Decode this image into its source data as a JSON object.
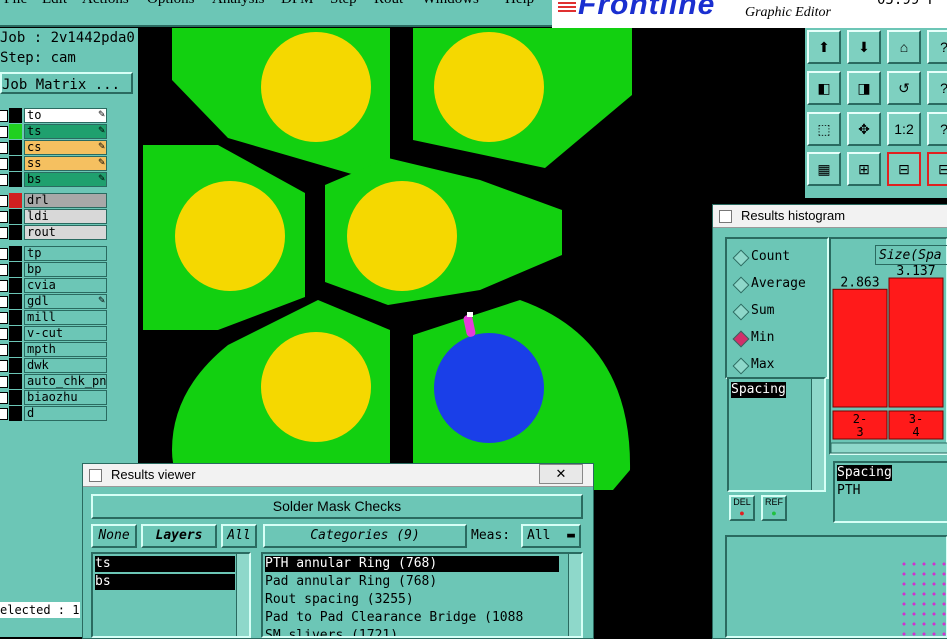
{
  "menu": {
    "items": [
      "File",
      "Edit",
      "Actions",
      "Options",
      "Analysis",
      "DFM",
      "Step",
      "Rout",
      "Windows",
      "Help"
    ]
  },
  "logo": {
    "brand": "Frontline",
    "subtitle": "Graphic Editor",
    "version": "05.99 F"
  },
  "job": {
    "name_line": "Job : 2v1442pda0",
    "step_line": "Step: cam",
    "matrix_label": "Job Matrix ..."
  },
  "layers": [
    {
      "name": "to",
      "color": "#ffffff",
      "editable": true
    },
    {
      "name": "ts",
      "color": "#1fa06e",
      "editable": true
    },
    {
      "name": "cs",
      "color": "#f5c060",
      "editable": true
    },
    {
      "name": "ss",
      "color": "#f5c060",
      "editable": true
    },
    {
      "name": "bs",
      "color": "#1fa06e",
      "editable": true
    },
    {
      "name": "drl",
      "color": "#a8a8a8",
      "editable": false
    },
    {
      "name": "ldi",
      "color": "#d8d8d8",
      "editable": false
    },
    {
      "name": "rout",
      "color": "#d8d8d8",
      "editable": false
    },
    {
      "name": "tp",
      "color": "#6cc6b6",
      "editable": false
    },
    {
      "name": "bp",
      "color": "#6cc6b6",
      "editable": false
    },
    {
      "name": "cvia",
      "color": "#6cc6b6",
      "editable": false
    },
    {
      "name": "gdl",
      "color": "#6cc6b6",
      "editable": true
    },
    {
      "name": "mill",
      "color": "#6cc6b6",
      "editable": false
    },
    {
      "name": "v-cut",
      "color": "#6cc6b6",
      "editable": false
    },
    {
      "name": "mpth",
      "color": "#6cc6b6",
      "editable": false
    },
    {
      "name": "dwk",
      "color": "#6cc6b6",
      "editable": false
    },
    {
      "name": "auto_chk_pn",
      "color": "#6cc6b6",
      "editable": false
    },
    {
      "name": "biaozhu",
      "color": "#6cc6b6",
      "editable": false
    },
    {
      "name": "d",
      "color": "#6cc6b6",
      "editable": false
    }
  ],
  "status": {
    "selected": "elected : 1"
  },
  "histogram": {
    "window_title": "Results histogram",
    "modes": [
      {
        "label": "Count",
        "selected": false
      },
      {
        "label": "Average",
        "selected": false
      },
      {
        "label": "Sum",
        "selected": false
      },
      {
        "label": "Min",
        "selected": true
      },
      {
        "label": "Max",
        "selected": false
      }
    ],
    "size_label": "Size(Spa",
    "list_items": [
      "Spacing"
    ],
    "del_label": "DEL",
    "ref_label": "REF",
    "lower_items": [
      "Spacing",
      "PTH"
    ]
  },
  "chart_data": {
    "type": "bar",
    "title": "Size(Spa",
    "categories": [
      "2-3",
      "3-4"
    ],
    "category_labels": [
      [
        "2-",
        "3"
      ],
      [
        "3-",
        "4"
      ]
    ],
    "values": [
      2.863,
      3.137
    ],
    "value_labels": [
      "2.863",
      "3.137"
    ],
    "colors": {
      "bar": "#ff1a1a"
    },
    "ylim": [
      0,
      3.6
    ]
  },
  "viewer": {
    "window_title": "Results viewer",
    "header": "Solder Mask Checks",
    "none_label": "None",
    "layers_label": "Layers",
    "all_label": "All",
    "categories_label": "Categories (9)",
    "meas_label": "Meas:",
    "meas_value": "All",
    "layer_items": [
      "ts",
      "bs"
    ],
    "category_items": [
      "PTH annular Ring (768)",
      "Pad annular Ring (768)",
      "Rout spacing (3255)",
      "Pad to Pad Clearance Bridge (1088",
      "SM slivers (1721)"
    ],
    "close_glyph": "✕"
  },
  "toolbar": {
    "buttons": [
      "⬆",
      "⬇",
      "⌂",
      "?",
      "◧",
      "◨",
      "↺",
      "1:2",
      "?",
      "⬚",
      "✥",
      "1:2",
      "?",
      "▦",
      "⊞",
      "⊟",
      "⊟"
    ]
  }
}
